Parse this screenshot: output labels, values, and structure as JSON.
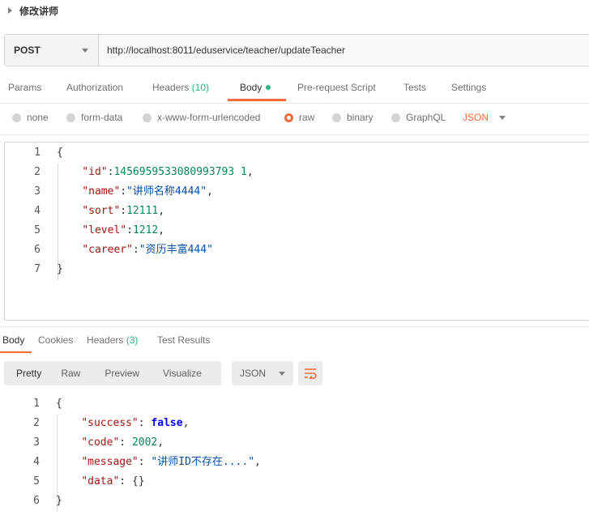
{
  "request": {
    "title": "修改讲师",
    "method": "POST",
    "url": "http://localhost:8011/eduservice/teacher/updateTeacher"
  },
  "request_tabs": [
    {
      "label": "Params"
    },
    {
      "label": "Authorization"
    },
    {
      "label": "Headers",
      "count": "(10)"
    },
    {
      "label": "Body"
    },
    {
      "label": "Pre-request Script"
    },
    {
      "label": "Tests"
    },
    {
      "label": "Settings"
    }
  ],
  "body_types": [
    "none",
    "form-data",
    "x-www-form-urlencoded",
    "raw",
    "binary",
    "GraphQL"
  ],
  "body_lang": "JSON",
  "request_body": {
    "line_numbers": [
      "1",
      "2",
      "3",
      "4",
      "5",
      "6",
      "7"
    ],
    "id_key": "\"id\"",
    "id_value": "1456959533080993793 1",
    "name_key": "\"name\"",
    "name_value": "\"讲师名称4444\"",
    "sort_key": "\"sort\"",
    "sort_value": "12111",
    "level_key": "\"level\"",
    "level_value": "1212",
    "career_key": "\"career\"",
    "career_value": "\"资历丰富444\""
  },
  "response_tabs": [
    {
      "label": "Body"
    },
    {
      "label": "Cookies"
    },
    {
      "label": "Headers",
      "count": "(3)"
    },
    {
      "label": "Test Results"
    }
  ],
  "response_views": [
    "Pretty",
    "Raw",
    "Preview",
    "Visualize"
  ],
  "response_format": "JSON",
  "response_body": {
    "line_numbers": [
      "1",
      "2",
      "3",
      "4",
      "5",
      "6"
    ],
    "success_key": "\"success\"",
    "success_value": "false",
    "code_key": "\"code\"",
    "code_value": "2002",
    "message_key": "\"message\"",
    "message_value": "\"讲师ID不存在....\"",
    "data_key": "\"data\"",
    "data_value": "{}"
  },
  "icons": {
    "expand": "caret-right-icon",
    "dropdown": "caret-down-icon",
    "wrap": "text-wrap-icon"
  },
  "colors": {
    "accent": "#f26b3a",
    "count": "#26b47f",
    "json_key": "#a31515",
    "json_number": "#098658",
    "json_string": "#0451a5",
    "json_keyword": "#0000ff"
  }
}
